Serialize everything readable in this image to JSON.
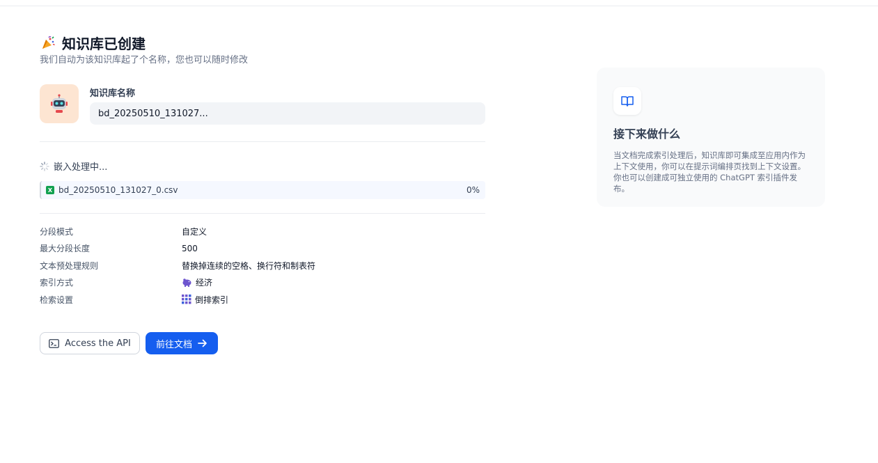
{
  "header": {
    "title": "知识库已创建",
    "subtitle": "我们自动为该知识库起了个名称，您也可以随时修改"
  },
  "kb": {
    "name_label": "知识库名称",
    "name_value": "bd_20250510_131027..."
  },
  "embedding": {
    "status": "嵌入处理中...",
    "file_name": "bd_20250510_131027_0.csv",
    "progress": "0%"
  },
  "settings": [
    {
      "key": "分段模式",
      "value": "自定义"
    },
    {
      "key": "最大分段长度",
      "value": "500"
    },
    {
      "key": "文本预处理规则",
      "value": "替换掉连续的空格、换行符和制表符"
    },
    {
      "key": "索引方式",
      "value": "经济",
      "icon": "piggy-bank-icon"
    },
    {
      "key": "检索设置",
      "value": "倒排索引",
      "icon": "grid-icon"
    }
  ],
  "actions": {
    "api_label": "Access the API",
    "doc_label": "前往文档"
  },
  "side": {
    "title": "接下来做什么",
    "text": "当文档完成索引处理后，知识库即可集成至应用内作为上下文使用，你可以在提示词编排页找到上下文设置。你也可以创建成可独立使用的 ChatGPT 索引插件发布。"
  },
  "colors": {
    "primary": "#155eef",
    "file_icon": "#12a150",
    "kb_icon_bg": "#fde5d2"
  }
}
